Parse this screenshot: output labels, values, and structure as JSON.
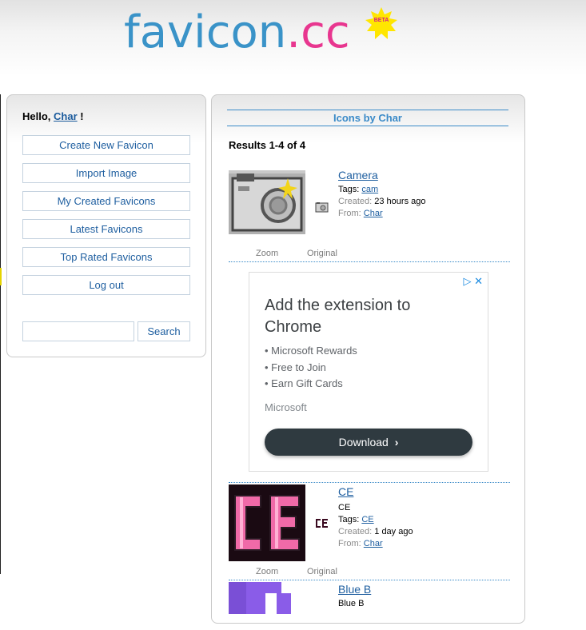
{
  "logo": {
    "main": "favicon",
    "dot": ".",
    "tld": "cc",
    "badge": "BETA"
  },
  "sidebar": {
    "hello_prefix": "Hello,",
    "user": "Char",
    "hello_suffix": "!",
    "buttons": [
      "Create New Favicon",
      "Import Image",
      "My Created Favicons",
      "Latest Favicons",
      "Top Rated Favicons",
      "Log out"
    ],
    "search_label": "Search",
    "search_value": ""
  },
  "main": {
    "title": "Icons by Char",
    "results": "Results 1-4 of 4",
    "zoom_caption": "Zoom",
    "original_caption": "Original",
    "labels": {
      "tags": "Tags:",
      "created": "Created:",
      "from": "From:"
    },
    "icons": [
      {
        "name": "Camera",
        "description": "",
        "tag": "cam",
        "created": "23 hours ago",
        "from": "Char"
      },
      {
        "name": "CE",
        "description": "CE",
        "tag": "CE",
        "created": "1 day ago",
        "from": "Char"
      },
      {
        "name": "Blue B",
        "description": "Blue B"
      }
    ]
  },
  "ad": {
    "title": "Add the extension to Chrome",
    "bullets": [
      "• Microsoft Rewards",
      "• Free to Join",
      "• Earn Gift Cards"
    ],
    "brand": "Microsoft",
    "button": "Download",
    "button_icon": "chevron-right-icon"
  },
  "colors": {
    "link": "#1f5fa0",
    "accent_blue": "#3a8ac8",
    "logo_pink": "#e8368f",
    "ad_button": "#2f3a40"
  }
}
